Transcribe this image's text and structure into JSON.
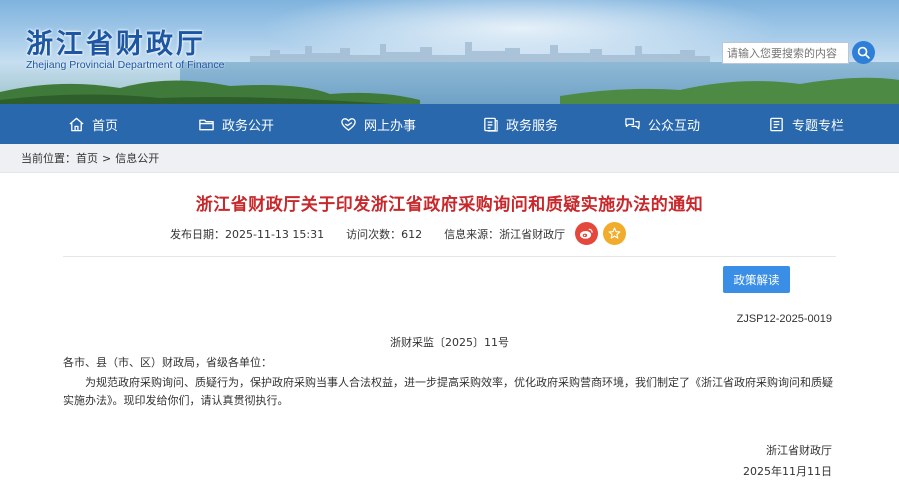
{
  "header": {
    "site_title": "浙江省财政厅",
    "site_subtitle": "Zhejiang Provincial Department of Finance",
    "search_placeholder": "请输入您要搜索的内容"
  },
  "nav": {
    "items": [
      {
        "label": "首页",
        "icon": "home-icon"
      },
      {
        "label": "政务公开",
        "icon": "folder-icon"
      },
      {
        "label": "网上办事",
        "icon": "heart-hands-icon"
      },
      {
        "label": "政务服务",
        "icon": "document-icon"
      },
      {
        "label": "公众互动",
        "icon": "chat-icon"
      },
      {
        "label": "专题专栏",
        "icon": "list-icon"
      }
    ]
  },
  "breadcrumb": {
    "prefix": "当前位置：",
    "items": [
      "首页",
      "信息公开"
    ],
    "separator": ">"
  },
  "article": {
    "title": "浙江省财政厅关于印发浙江省政府采购询问和质疑实施办法的通知",
    "publish_date": "发布日期：2025-11-13 15:31",
    "visits": "访问次数：612",
    "source": "信息来源：浙江省财政厅",
    "policy_button": "政策解读",
    "doc_id": "ZJSP12-2025-0019",
    "doc_number": "浙财采监〔2025〕11号",
    "salutation": "各市、县（市、区）财政局，省级各单位：",
    "paragraph": "为规范政府采购询问、质疑行为，保护政府采购当事人合法权益，进一步提高采购效率，优化政府采购营商环境，我们制定了《浙江省政府采购询问和质疑实施办法》。现印发给你们，请认真贯彻执行。",
    "sign_org": "浙江省财政厅",
    "sign_date": "2025年11月11日"
  },
  "colors": {
    "nav_bg": "#2968ad",
    "title_red": "#c8282b",
    "button_blue": "#3a8ee6",
    "weibo_red": "#e4473b",
    "favorite_orange": "#f0ac2a"
  }
}
